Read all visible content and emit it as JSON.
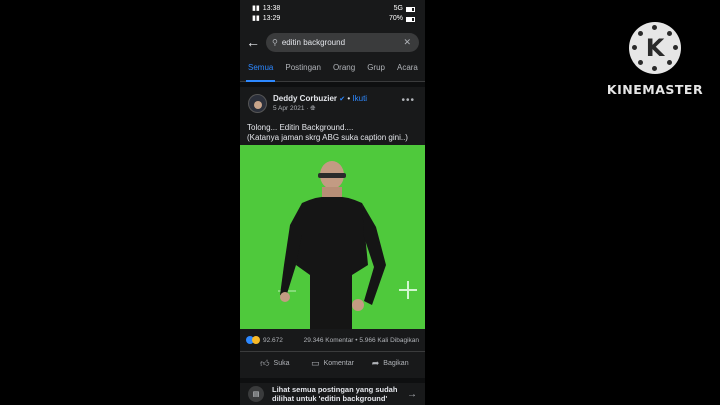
{
  "status": {
    "time_top": "13:38",
    "time": "13:29",
    "network": "5G",
    "battery": "70%",
    "battery_level": 0.7
  },
  "search": {
    "value": "editin background",
    "back_icon": "arrow-left-icon",
    "search_icon": "search-icon",
    "clear_icon": "close-icon"
  },
  "tabs": [
    "Semua",
    "Postingan",
    "Orang",
    "Grup",
    "Acara"
  ],
  "active_tab": 0,
  "post": {
    "author": "Deddy Corbuzier",
    "follow": "Ikuti",
    "separator": "•",
    "date": "5 Apr 2021 ·",
    "privacy_icon": "globe-icon",
    "more_icon": "more-horizontal-icon",
    "caption_line1": "Tolong... Editin Background....",
    "caption_line2": "(Katanya jaman skrg ABG suka caption gini..)",
    "reactions_count": "92.672",
    "stats_text": "29.346 Komentar • 5.966 Kali Dibagikan",
    "actions": [
      {
        "label": "Suka",
        "icon": "thumbs-up-icon"
      },
      {
        "label": "Komentar",
        "icon": "comment-icon"
      },
      {
        "label": "Bagikan",
        "icon": "share-icon"
      }
    ]
  },
  "see_all": {
    "line1": "Lihat semua postingan yang sudah",
    "line2": "dilihat untuk 'editin background'"
  },
  "watermark": {
    "name": "KINEMASTER",
    "logo_letter": "K"
  },
  "colors": {
    "accent": "#2d88ff",
    "green_screen": "#4fc93c",
    "background": "#18191a"
  }
}
